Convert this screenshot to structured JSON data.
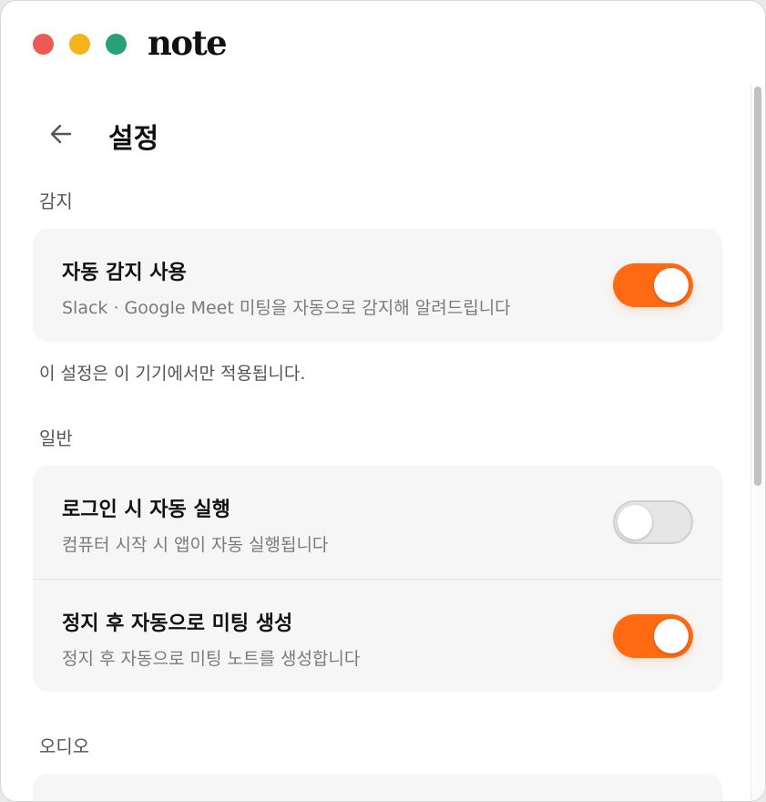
{
  "app": {
    "name": "note"
  },
  "page": {
    "title": "설정"
  },
  "sections": {
    "detection": {
      "label": "감지",
      "auto_detect": {
        "title": "자동 감지 사용",
        "description": "Slack · Google Meet 미팅을 자동으로 감지해 알려드립니다",
        "enabled": true
      },
      "note": "이 설정은 이 기기에서만 적용됩니다."
    },
    "general": {
      "label": "일반",
      "launch_at_login": {
        "title": "로그인 시 자동 실행",
        "description": "컴퓨터 시작 시 앱이 자동 실행됩니다",
        "enabled": false
      },
      "auto_create_meeting": {
        "title": "정지 후 자동으로 미팅 생성",
        "description": "정지 후 자동으로 미팅 노트를 생성합니다",
        "enabled": true
      }
    },
    "audio": {
      "label": "오디오"
    }
  },
  "colors": {
    "accent": "#ff6a12",
    "close": "#ec5a53",
    "minimize": "#f5b31c",
    "maximize": "#2aa078"
  },
  "icons": {
    "back": "arrow-left-icon"
  }
}
